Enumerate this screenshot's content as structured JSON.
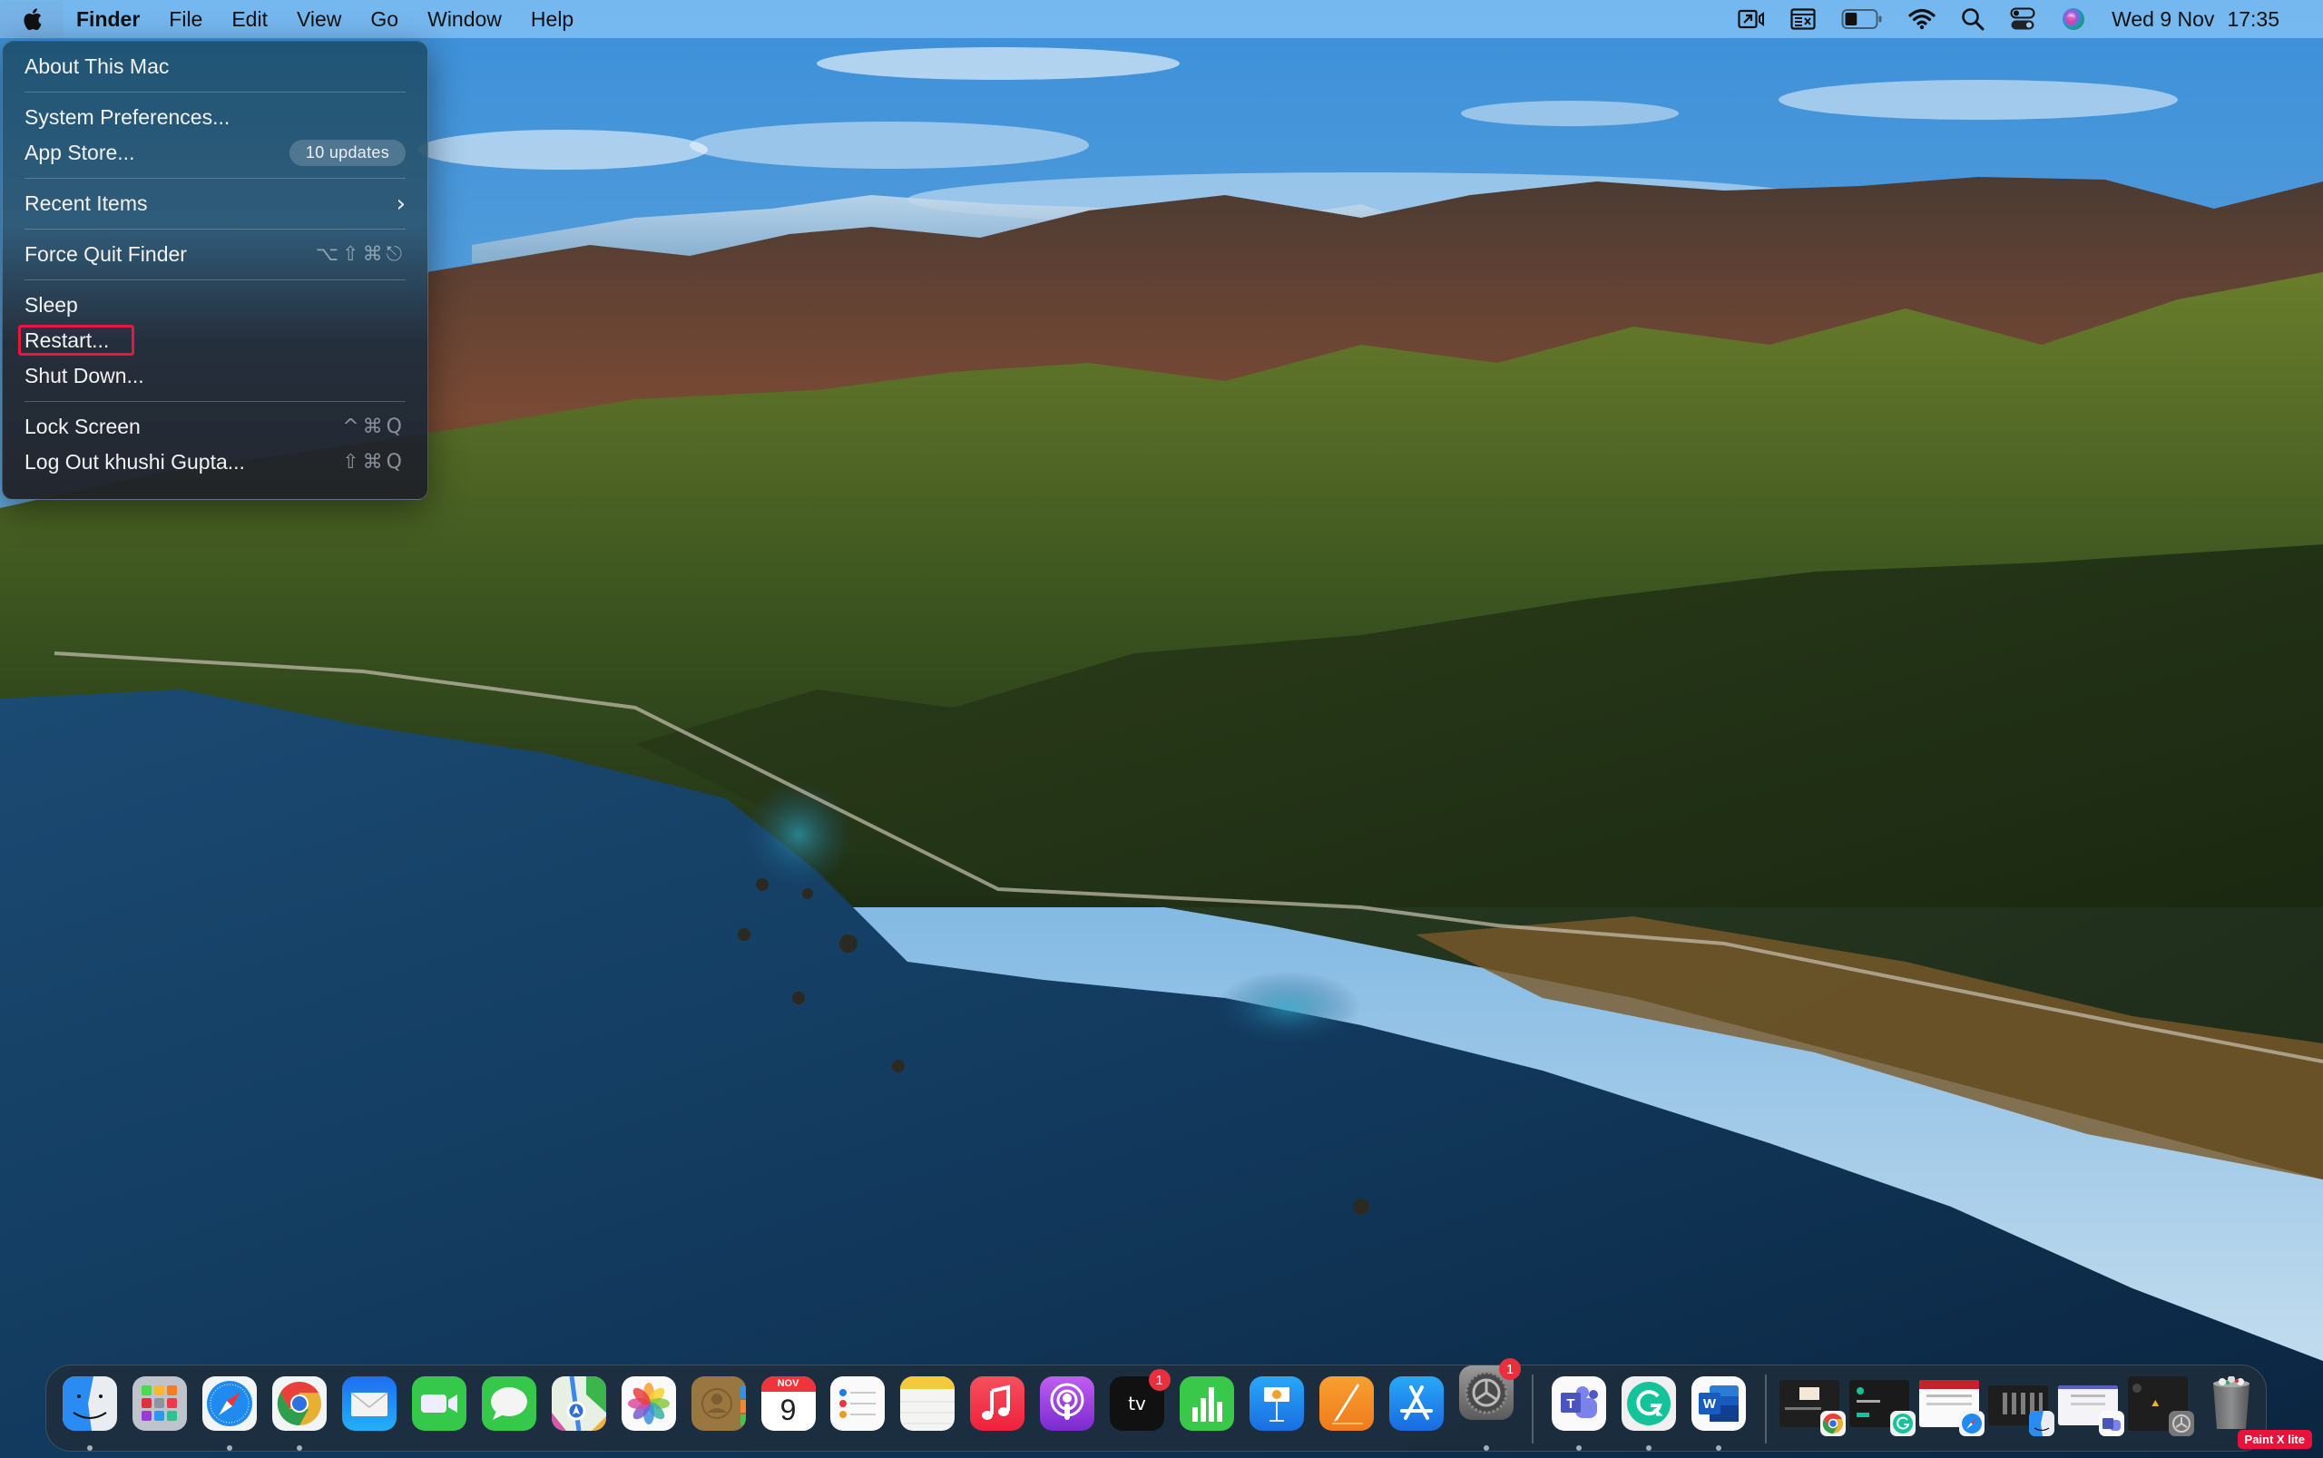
{
  "menubar": {
    "apple_icon": "apple-logo",
    "app_name": "Finder",
    "menus": [
      "File",
      "Edit",
      "View",
      "Go",
      "Window",
      "Help"
    ],
    "status_icons": [
      "screen-mirroring-icon",
      "input-source-icon",
      "battery-icon",
      "wifi-icon",
      "spotlight-search-icon",
      "control-center-icon",
      "siri-icon"
    ],
    "clock": {
      "date": "Wed 9 Nov",
      "time": "17:35"
    },
    "battery_level_percent": 40
  },
  "apple_menu": {
    "items": [
      {
        "label": "About This Mac"
      },
      {
        "label": "System Preferences..."
      },
      {
        "label": "App Store...",
        "badge": "10 updates"
      },
      {
        "label": "Recent Items",
        "submenu_glyph": "›"
      },
      {
        "label": "Force Quit Finder",
        "shortcut": "⌥⇧⌘⎋"
      },
      {
        "label": "Sleep"
      },
      {
        "label": "Restart...",
        "highlighted": true
      },
      {
        "label": "Shut Down..."
      },
      {
        "label": "Lock Screen",
        "shortcut": "^⌘Q"
      },
      {
        "label": "Log Out khushi Gupta...",
        "shortcut": "⇧⌘Q"
      }
    ],
    "highlight_color": "#e8163d"
  },
  "dock": {
    "apps": [
      {
        "name": "Finder",
        "running": true
      },
      {
        "name": "Launchpad",
        "running": false
      },
      {
        "name": "Safari",
        "running": true
      },
      {
        "name": "Google Chrome",
        "running": true
      },
      {
        "name": "Mail",
        "running": false
      },
      {
        "name": "FaceTime",
        "running": false
      },
      {
        "name": "Messages",
        "running": false
      },
      {
        "name": "Maps",
        "running": false
      },
      {
        "name": "Photos",
        "running": false
      },
      {
        "name": "Contacts",
        "running": false
      },
      {
        "name": "Calendar",
        "running": false,
        "month": "NOV",
        "day": "9"
      },
      {
        "name": "Reminders",
        "running": false
      },
      {
        "name": "Notes",
        "running": false
      },
      {
        "name": "Music",
        "running": false
      },
      {
        "name": "Podcasts",
        "running": false
      },
      {
        "name": "Apple TV",
        "running": false,
        "badge": "1",
        "label": "tv"
      },
      {
        "name": "Numbers",
        "running": false
      },
      {
        "name": "Keynote",
        "running": false
      },
      {
        "name": "Pages",
        "running": false
      },
      {
        "name": "App Store",
        "running": false
      },
      {
        "name": "System Preferences",
        "running": true,
        "badge": "1"
      }
    ],
    "recent_apps": [
      {
        "name": "Microsoft Teams",
        "running": true,
        "letter": "T"
      },
      {
        "name": "Grammarly",
        "running": true,
        "letter": "G"
      },
      {
        "name": "Microsoft Word",
        "running": true,
        "letter": "W"
      }
    ],
    "minimized_windows": [
      {
        "app": "Google Chrome"
      },
      {
        "app": "Grammarly"
      },
      {
        "app": "Safari"
      },
      {
        "app": "Finder"
      },
      {
        "app": "Microsoft Teams"
      },
      {
        "app": "System Preferences"
      }
    ],
    "trash": {
      "name": "Trash",
      "full": true
    }
  },
  "watermark": "Paint X lite"
}
